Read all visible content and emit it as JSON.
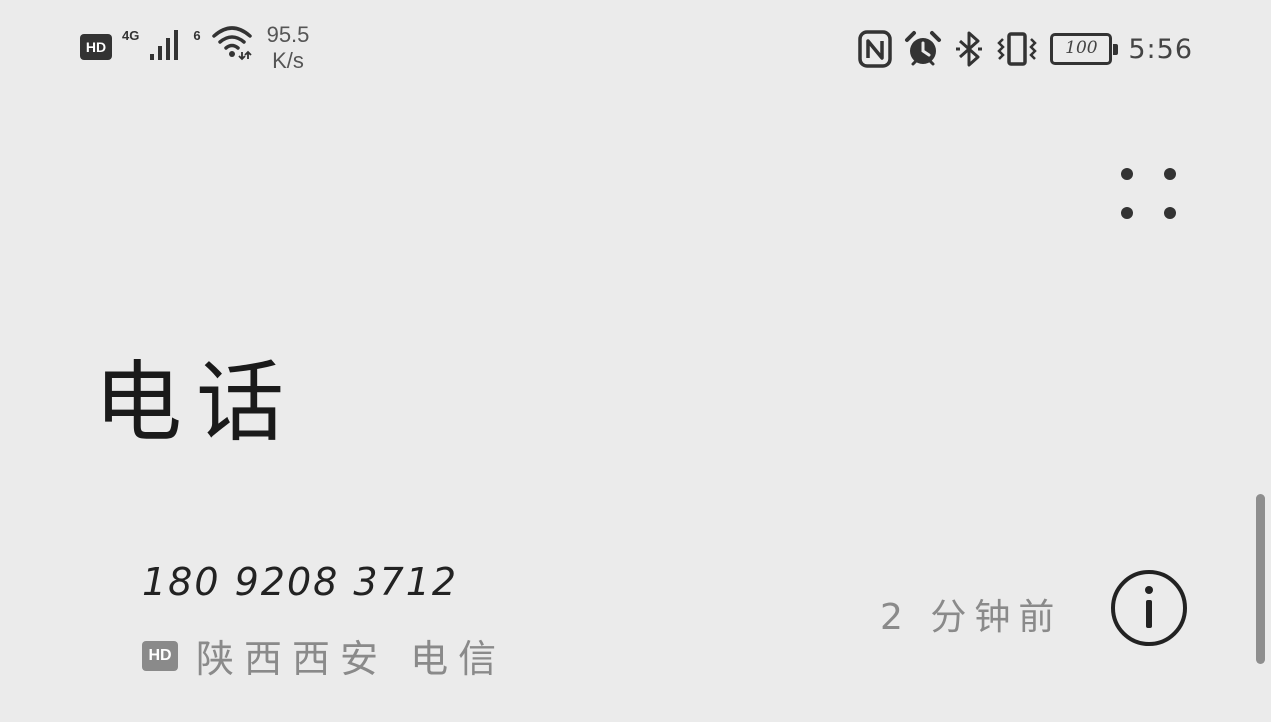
{
  "status_bar": {
    "hd": "HD",
    "network": "4G",
    "wifi_tag": "6",
    "speed_value": "95.5",
    "speed_unit": "K/s",
    "battery_level": "100",
    "time": "5:56",
    "icons": [
      "nfc-icon",
      "alarm-icon",
      "bluetooth-icon",
      "vibrate-icon",
      "battery-icon"
    ]
  },
  "page": {
    "title": "电话"
  },
  "recent_call": {
    "number": "180 9208 3712",
    "hd": "HD",
    "location": "陕西西安 电信",
    "time_ago": "2 分钟前"
  },
  "colors": {
    "background": "#ebebeb",
    "text_primary": "#222222",
    "text_secondary": "#8a8a8a",
    "scrollbar": "#8e8e8e"
  }
}
